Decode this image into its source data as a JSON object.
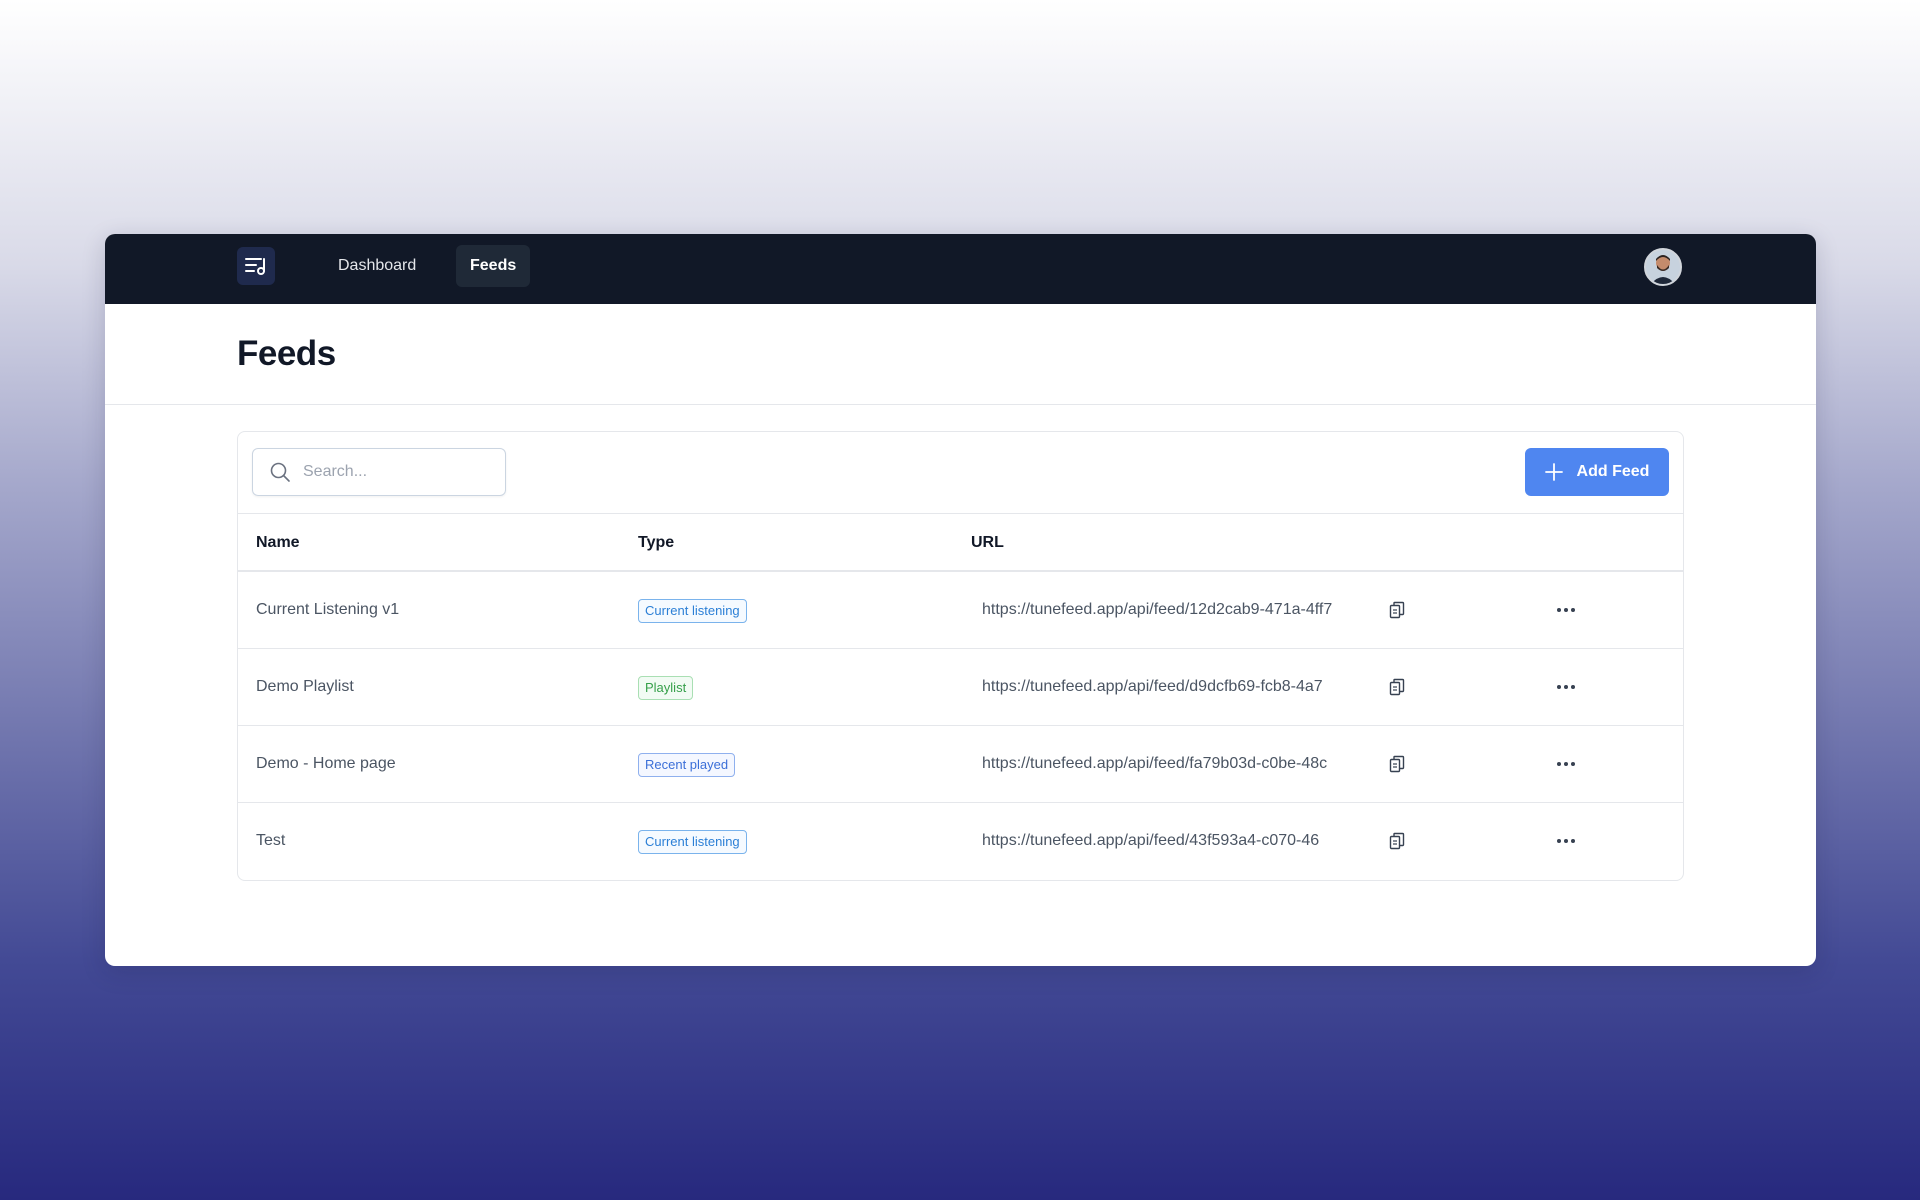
{
  "nav": {
    "logo_icon": "music-list-icon",
    "items": [
      {
        "label": "Dashboard",
        "active": false
      },
      {
        "label": "Feeds",
        "active": true
      }
    ],
    "avatar_icon": "user-avatar"
  },
  "page": {
    "title": "Feeds"
  },
  "toolbar": {
    "search_placeholder": "Search...",
    "search_value": "",
    "add_label": "Add Feed",
    "add_color": "#4f86f0"
  },
  "table": {
    "columns": [
      "Name",
      "Type",
      "URL"
    ],
    "rows": [
      {
        "name": "Current Listening v1",
        "type": "Current listening",
        "type_color": "blue",
        "url": "https://tunefeed.app/api/feed/12d2cab9-471a-4ff7"
      },
      {
        "name": "Demo Playlist",
        "type": "Playlist",
        "type_color": "green",
        "url": "https://tunefeed.app/api/feed/d9dcfb69-fcb8-4a7"
      },
      {
        "name": "Demo - Home page",
        "type": "Recent played",
        "type_color": "indigo",
        "url": "https://tunefeed.app/api/feed/fa79b03d-c0be-48c"
      },
      {
        "name": "Test",
        "type": "Current listening",
        "type_color": "blue",
        "url": "https://tunefeed.app/api/feed/43f593a4-c070-46"
      }
    ]
  }
}
